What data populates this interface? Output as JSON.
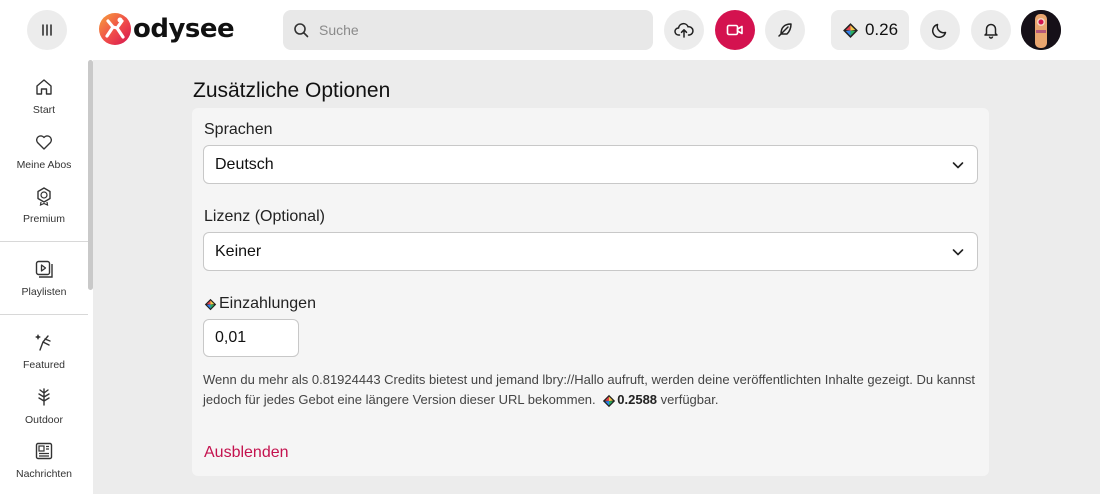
{
  "header": {
    "logo_text": "odysee",
    "search_placeholder": "Suche",
    "balance": "0.26",
    "brand_color": "#d4124f"
  },
  "sidebar": {
    "items": [
      {
        "label": "Start",
        "icon": "home-icon"
      },
      {
        "label": "Meine Abos",
        "icon": "heart-icon"
      },
      {
        "label": "Premium",
        "icon": "premium-badge-icon"
      },
      {
        "label": "Playlisten",
        "icon": "playlist-icon"
      },
      {
        "label": "Featured",
        "icon": "featured-icon"
      },
      {
        "label": "Outdoor",
        "icon": "tree-icon"
      },
      {
        "label": "Nachrichten",
        "icon": "news-icon"
      }
    ]
  },
  "main": {
    "section_title": "Zusätzliche Optionen",
    "language_label": "Sprachen",
    "language_value": "Deutsch",
    "license_label": "Lizenz (Optional)",
    "license_value": "Keiner",
    "deposit_label": "Einzahlungen",
    "deposit_value": "0,01",
    "help_text_before": "Wenn du mehr als 0.81924443 Credits bietest und jemand lbry://Hallo aufruft, werden deine veröffentlichten Inhalte gezeigt. Du kannst jedoch für jedes Gebot eine längere Version dieser URL bekommen.",
    "help_balance": "0.2588",
    "help_text_after": "verfügbar.",
    "hide_link": "Ausblenden"
  }
}
